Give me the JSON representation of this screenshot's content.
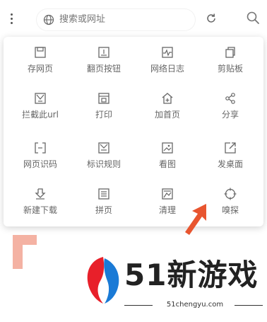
{
  "toolbar": {
    "search_placeholder": "搜索或网址",
    "icons": [
      "more-vertical-icon",
      "globe-icon",
      "refresh-icon",
      "search-icon"
    ]
  },
  "menu": {
    "items": [
      {
        "label": "存网页",
        "icon": "save-icon"
      },
      {
        "label": "翻页按钮",
        "icon": "page-button-icon"
      },
      {
        "label": "网络日志",
        "icon": "network-log-icon"
      },
      {
        "label": "剪贴板",
        "icon": "clipboard-icon"
      },
      {
        "label": "拦截此url",
        "icon": "block-url-icon"
      },
      {
        "label": "打印",
        "icon": "print-icon"
      },
      {
        "label": "加首页",
        "icon": "add-home-icon"
      },
      {
        "label": "分享",
        "icon": "share-icon"
      },
      {
        "label": "网页识码",
        "icon": "scan-code-icon"
      },
      {
        "label": "标识规则",
        "icon": "rule-icon"
      },
      {
        "label": "看图",
        "icon": "image-view-icon"
      },
      {
        "label": "发桌面",
        "icon": "send-desktop-icon"
      },
      {
        "label": "新建下载",
        "icon": "download-icon"
      },
      {
        "label": "拼页",
        "icon": "merge-pages-icon"
      },
      {
        "label": "清理",
        "icon": "clean-icon"
      },
      {
        "label": "嗅探",
        "icon": "sniff-icon"
      }
    ]
  },
  "watermark": {
    "brand": "51新游戏",
    "domain": "51chengyu.com"
  },
  "colors": {
    "accent": "#e8552f",
    "text": "#666666",
    "logo_red": "#e8202a",
    "logo_blue": "#1a7ad6"
  }
}
